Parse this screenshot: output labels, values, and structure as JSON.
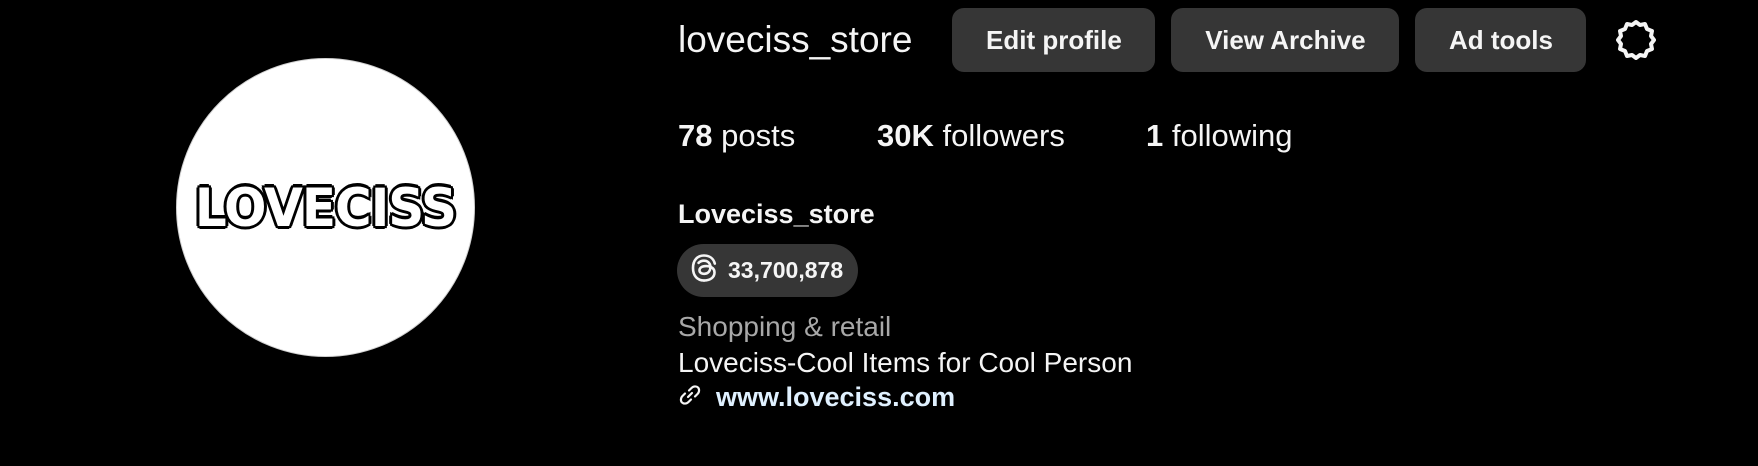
{
  "avatar": {
    "logo_text": "LOVECISS"
  },
  "header": {
    "username": "loveciss_store",
    "edit_profile_label": "Edit profile",
    "view_archive_label": "View Archive",
    "ad_tools_label": "Ad tools",
    "settings_icon": "gear-icon"
  },
  "stats": {
    "posts": {
      "count": "78",
      "label": "posts"
    },
    "followers": {
      "count": "30K",
      "label": "followers"
    },
    "following": {
      "count": "1",
      "label": "following"
    }
  },
  "bio": {
    "display_name": "Loveciss_store",
    "threads": {
      "icon": "threads-icon",
      "count": "33,700,878"
    },
    "category": "Shopping & retail",
    "text": "Loveciss-Cool Items for Cool Person",
    "link": {
      "icon": "link-icon",
      "text": "www.loveciss.com"
    }
  },
  "colors": {
    "background": "#000000",
    "button_bg": "#363636",
    "text_primary": "#f5f5f5",
    "text_secondary": "#a8a8a8"
  }
}
